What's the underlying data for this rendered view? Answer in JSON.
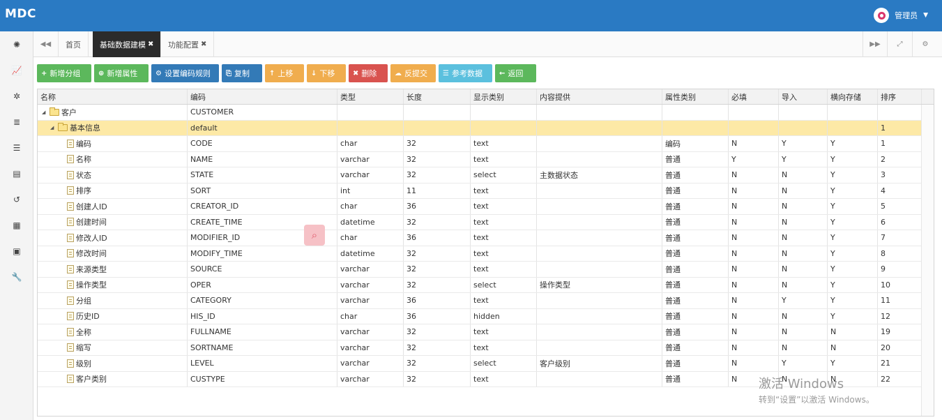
{
  "app": {
    "title": "MDC",
    "user": "管理员"
  },
  "tabs": [
    {
      "label": "首页",
      "closable": false,
      "active": false
    },
    {
      "label": "基础数据建模",
      "closable": true,
      "active": true
    },
    {
      "label": "功能配置",
      "closable": true,
      "active": false
    }
  ],
  "sidebar_icons": [
    "dashboard-icon",
    "chart-icon",
    "settings-icon",
    "database-icon",
    "menu-icon",
    "list-icon",
    "history-icon",
    "film-icon",
    "archive-icon",
    "wrench-icon"
  ],
  "toolbar": [
    {
      "label": "新增分组",
      "icon": "+",
      "color": "green"
    },
    {
      "label": "新增属性",
      "icon": "⊕",
      "color": "green"
    },
    {
      "label": "设置编码规则",
      "icon": "⚙",
      "color": "blue"
    },
    {
      "label": "复制",
      "icon": "⎘",
      "color": "blue"
    },
    {
      "label": "上移",
      "icon": "↑",
      "color": "orange"
    },
    {
      "label": "下移",
      "icon": "↓",
      "color": "orange"
    },
    {
      "label": "删除",
      "icon": "✖",
      "color": "red"
    },
    {
      "label": "反提交",
      "icon": "☁",
      "color": "orange"
    },
    {
      "label": "参考数据",
      "icon": "☰",
      "color": "cyan"
    },
    {
      "label": "返回",
      "icon": "←",
      "color": "green"
    }
  ],
  "grid": {
    "columns": [
      "名称",
      "编码",
      "类型",
      "长度",
      "显示类别",
      "内容提供",
      "属性类别",
      "必填",
      "导入",
      "横向存储",
      "排序"
    ],
    "rows": [
      {
        "level": 0,
        "kind": "folder",
        "cells": [
          "客户",
          "CUSTOMER",
          "",
          "",
          "",
          "",
          "",
          "",
          "",
          "",
          ""
        ]
      },
      {
        "level": 1,
        "kind": "folder",
        "selected": true,
        "cells": [
          "基本信息",
          "default",
          "",
          "",
          "",
          "",
          "",
          "",
          "",
          "",
          "1"
        ]
      },
      {
        "level": 2,
        "kind": "file",
        "cells": [
          "编码",
          "CODE",
          "char",
          "32",
          "text",
          "",
          "编码",
          "N",
          "Y",
          "Y",
          "1"
        ]
      },
      {
        "level": 2,
        "kind": "file",
        "cells": [
          "名称",
          "NAME",
          "varchar",
          "32",
          "text",
          "",
          "普通",
          "Y",
          "Y",
          "Y",
          "2"
        ]
      },
      {
        "level": 2,
        "kind": "file",
        "cells": [
          "状态",
          "STATE",
          "varchar",
          "32",
          "select",
          "主数据状态",
          "普通",
          "N",
          "N",
          "Y",
          "3"
        ]
      },
      {
        "level": 2,
        "kind": "file",
        "cells": [
          "排序",
          "SORT",
          "int",
          "11",
          "text",
          "",
          "普通",
          "N",
          "N",
          "Y",
          "4"
        ]
      },
      {
        "level": 2,
        "kind": "file",
        "cells": [
          "创建人ID",
          "CREATOR_ID",
          "char",
          "36",
          "text",
          "",
          "普通",
          "N",
          "N",
          "Y",
          "5"
        ]
      },
      {
        "level": 2,
        "kind": "file",
        "cells": [
          "创建时间",
          "CREATE_TIME",
          "datetime",
          "32",
          "text",
          "",
          "普通",
          "N",
          "N",
          "Y",
          "6"
        ]
      },
      {
        "level": 2,
        "kind": "file",
        "cells": [
          "修改人ID",
          "MODIFIER_ID",
          "char",
          "36",
          "text",
          "",
          "普通",
          "N",
          "N",
          "Y",
          "7"
        ]
      },
      {
        "level": 2,
        "kind": "file",
        "cells": [
          "修改时间",
          "MODIFY_TIME",
          "datetime",
          "32",
          "text",
          "",
          "普通",
          "N",
          "N",
          "Y",
          "8"
        ]
      },
      {
        "level": 2,
        "kind": "file",
        "cells": [
          "来源类型",
          "SOURCE",
          "varchar",
          "32",
          "text",
          "",
          "普通",
          "N",
          "N",
          "Y",
          "9"
        ]
      },
      {
        "level": 2,
        "kind": "file",
        "cells": [
          "操作类型",
          "OPER",
          "varchar",
          "32",
          "select",
          "操作类型",
          "普通",
          "N",
          "N",
          "Y",
          "10"
        ]
      },
      {
        "level": 2,
        "kind": "file",
        "cells": [
          "分组",
          "CATEGORY",
          "varchar",
          "36",
          "text",
          "",
          "普通",
          "N",
          "Y",
          "Y",
          "11"
        ]
      },
      {
        "level": 2,
        "kind": "file",
        "cells": [
          "历史ID",
          "HIS_ID",
          "char",
          "36",
          "hidden",
          "",
          "普通",
          "N",
          "N",
          "Y",
          "12"
        ]
      },
      {
        "level": 2,
        "kind": "file",
        "cells": [
          "全称",
          "FULLNAME",
          "varchar",
          "32",
          "text",
          "",
          "普通",
          "N",
          "N",
          "N",
          "19"
        ]
      },
      {
        "level": 2,
        "kind": "file",
        "cells": [
          "缩写",
          "SORTNAME",
          "varchar",
          "32",
          "text",
          "",
          "普通",
          "N",
          "N",
          "N",
          "20"
        ]
      },
      {
        "level": 2,
        "kind": "file",
        "cells": [
          "级别",
          "LEVEL",
          "varchar",
          "32",
          "select",
          "客户级别",
          "普通",
          "N",
          "Y",
          "Y",
          "21"
        ]
      },
      {
        "level": 2,
        "kind": "file",
        "cells": [
          "客户类别",
          "CUSTYPE",
          "varchar",
          "32",
          "text",
          "",
          "普通",
          "N",
          "N",
          "N",
          "22"
        ]
      }
    ]
  },
  "watermark": {
    "line1": "激活 Windows",
    "line2": "转到“设置”以激活 Windows。"
  }
}
